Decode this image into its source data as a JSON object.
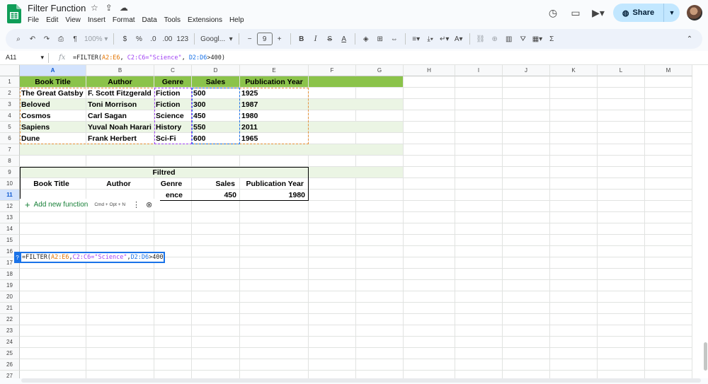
{
  "doc": {
    "title": "Filter Function",
    "menus": [
      "File",
      "Edit",
      "View",
      "Insert",
      "Format",
      "Data",
      "Tools",
      "Extensions",
      "Help"
    ],
    "share_label": "Share"
  },
  "toolbar": {
    "zoom": "100%",
    "currency": "$",
    "percent": "%",
    "dec_decrease": ".0",
    "dec_increase": ".00",
    "number_format": "123",
    "font": "Googl...",
    "font_size": "9",
    "bold": "B",
    "italic": "I",
    "strike": "S",
    "text_color": "A"
  },
  "formula_bar": {
    "cell_ref": "A11",
    "fx": "fx",
    "parts": [
      "=FILTER(",
      "A2:E6",
      ", ",
      "C2:C6=\"Science\"",
      ", ",
      "D2:D6",
      ">400)"
    ]
  },
  "columns": [
    "A",
    "B",
    "C",
    "D",
    "E",
    "F",
    "G",
    "H",
    "I",
    "J",
    "K",
    "L",
    "M"
  ],
  "rows": [
    "1",
    "2",
    "3",
    "4",
    "5",
    "6",
    "7",
    "8",
    "9",
    "10",
    "11",
    "12",
    "13",
    "14",
    "15",
    "16",
    "17",
    "18",
    "19",
    "20",
    "21",
    "22",
    "23",
    "24",
    "25",
    "26",
    "27"
  ],
  "table": {
    "headers": [
      "Book Title",
      "Author",
      "Genre",
      "Sales",
      "Publication Year"
    ],
    "rows": [
      [
        "The Great Gatsby",
        "F. Scott Fitzgerald",
        "Fiction",
        "500",
        "1925"
      ],
      [
        "Beloved",
        "Toni Morrison",
        "Fiction",
        "300",
        "1987"
      ],
      [
        "Cosmos",
        "Carl Sagan",
        "Science",
        "450",
        "1980"
      ],
      [
        "Sapiens",
        "Yuval Noah Harari",
        "History",
        "550",
        "2011"
      ],
      [
        "Dune",
        "Frank Herbert",
        "Sci-Fi",
        "600",
        "1965"
      ]
    ]
  },
  "filtered": {
    "title": "Filtred",
    "headers": [
      "Book Title",
      "Author",
      "Genre",
      "Sales",
      "Publication Year"
    ],
    "result": {
      "genre_partial": "ence",
      "sales": "450",
      "year": "1980"
    }
  },
  "editor": {
    "parts": [
      "=FILTER(",
      "A2:E6",
      ", ",
      "C2:C6=\"Science\"",
      ", ",
      "D2:D6",
      ">400)"
    ],
    "badge": "?"
  },
  "add_function": {
    "label": "Add new function",
    "shortcut": "Cmd + Opt + N"
  },
  "colors": {
    "header_green": "#8bc34a",
    "alt_row": "#ebf5e4",
    "range_orange": "#e69138",
    "range_purple": "#a142f4",
    "range_blue": "#1a73e8",
    "share_bg": "#c2e7ff"
  }
}
